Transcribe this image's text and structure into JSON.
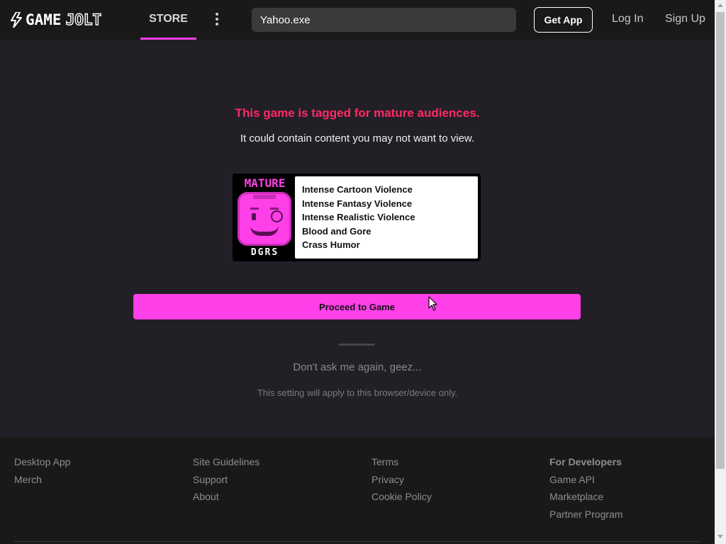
{
  "nav": {
    "logo_game": "GAME",
    "logo_jolt": "JOLT",
    "store_label": "STORE",
    "search_value": "Yahoo.exe",
    "get_app_label": "Get App",
    "login_label": "Log In",
    "signup_label": "Sign Up"
  },
  "warning": {
    "title": "This game is tagged for mature audiences.",
    "subtitle": "It could contain content you may not want to view."
  },
  "rating": {
    "badge_top": "MATURE",
    "badge_bottom": "DGRS",
    "descriptors": [
      "Intense Cartoon Violence",
      "Intense Fantasy Violence",
      "Intense Realistic Violence",
      "Blood and Gore",
      "Crass Humor"
    ]
  },
  "actions": {
    "proceed_label": "Proceed to Game",
    "dont_ask_label": "Don't ask me again, geez...",
    "setting_note": "This setting will apply to this browser/device only."
  },
  "footer": {
    "col1": [
      "Desktop App",
      "Merch"
    ],
    "col2": [
      "Site Guidelines",
      "Support",
      "About"
    ],
    "col3": [
      "Terms",
      "Privacy",
      "Cookie Policy"
    ],
    "col4_heading": "For Developers",
    "col4": [
      "Game API",
      "Marketplace",
      "Partner Program"
    ]
  },
  "colors": {
    "accent": "#ff3fe8",
    "warning": "#ff2a66",
    "background": "#231f27",
    "nav_background": "#191919"
  },
  "icons": {
    "logo": "lightning-bolt-icon",
    "more": "vertical-dots-icon",
    "cursor": "mouse-pointer-icon"
  }
}
